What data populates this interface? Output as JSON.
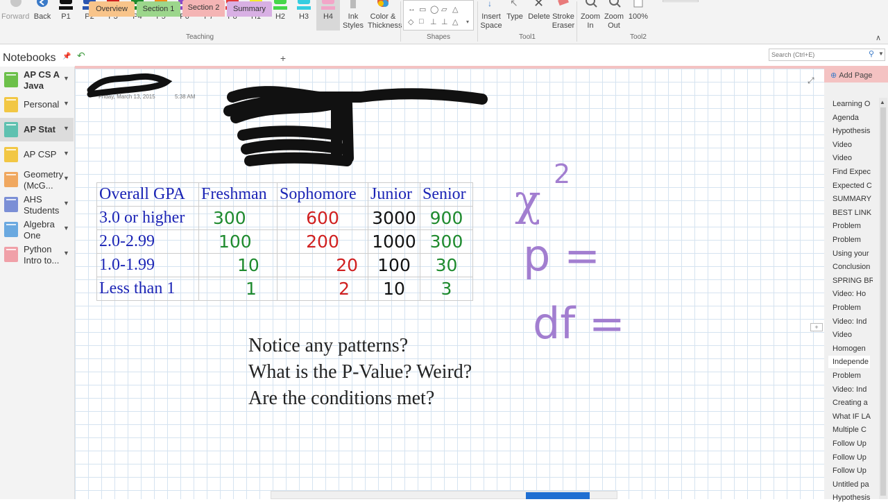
{
  "ribbon": {
    "history": [
      {
        "label": "Forward",
        "icon": "forward-arrow-icon"
      },
      {
        "label": "Back",
        "icon": "back-arrow-icon"
      }
    ],
    "pens": [
      {
        "label": "P1",
        "color": "#111111"
      },
      {
        "label": "P2",
        "color": "#2b55b0"
      },
      {
        "label": "P3",
        "color": "#d02020"
      },
      {
        "label": "P4",
        "color": "#1e8a2e"
      },
      {
        "label": "P5",
        "color": "#f08c1a"
      },
      {
        "label": "P6",
        "color": "#8a48c8"
      },
      {
        "label": "P7",
        "color": "#2eb34a"
      },
      {
        "label": "P8",
        "color": "#e23b3b"
      },
      {
        "label": "H1",
        "color": "#f5ee2a"
      },
      {
        "label": "H2",
        "color": "#46d64a"
      },
      {
        "label": "H3",
        "color": "#36cde0"
      },
      {
        "label": "H4",
        "color": "#f2a6c8"
      }
    ],
    "selected_pen": "H4",
    "ink_styles": "Ink\nStyles",
    "color_thickness": "Color &\nThickness",
    "groups": {
      "teaching": "Teaching",
      "shapes": "Shapes",
      "tool1": "Tool1",
      "tool2": "Tool2"
    },
    "tools": [
      {
        "label": "Insert\nSpace",
        "icon": "insert-space-icon"
      },
      {
        "label": "Type",
        "icon": "type-cursor-icon"
      },
      {
        "label": "Delete",
        "icon": "delete-x-icon"
      },
      {
        "label": "Stroke\nEraser",
        "icon": "eraser-icon"
      },
      {
        "label": "Zoom\nIn",
        "icon": "zoom-in-icon"
      },
      {
        "label": "Zoom\nOut",
        "icon": "zoom-out-icon"
      },
      {
        "label": "100%",
        "icon": "page-icon"
      }
    ]
  },
  "notebooks": {
    "title": "Notebooks",
    "items": [
      {
        "label": "AP CS A Java",
        "color": "#6cc04a"
      },
      {
        "label": "Personal",
        "color": "#f2c744"
      },
      {
        "label": "AP Stat",
        "color": "#5fc1b0"
      },
      {
        "label": "AP CSP",
        "color": "#f2c744"
      },
      {
        "label": "Geometry (McG...",
        "color": "#f0a860"
      },
      {
        "label": "AHS Students",
        "color": "#7b8fd6"
      },
      {
        "label": "Algebra One",
        "color": "#6aa9e0"
      },
      {
        "label": "Python Intro to...",
        "color": "#f0a0a8"
      }
    ],
    "active": "AP Stat"
  },
  "sections": {
    "tabs": [
      {
        "label": "Overview",
        "color": "#f8c48a"
      },
      {
        "label": "Section 1",
        "color": "#9cd68c"
      },
      {
        "label": "Section 2",
        "color": "#f4b4b4"
      },
      {
        "label": "Summary",
        "color": "#d8b0e4"
      }
    ],
    "active": "Section 2",
    "add_label": "+"
  },
  "search": {
    "placeholder": "Search (Ctrl+E)"
  },
  "page": {
    "date": "Friday, March 13, 2015",
    "time": "5:38 AM",
    "table": {
      "headers": [
        "Overall GPA",
        "Freshman",
        "Sophomore",
        "Junior",
        "Senior"
      ],
      "rows": [
        {
          "label": "3.0 or higher",
          "values": [
            "300",
            "600",
            "3000",
            "900"
          ]
        },
        {
          "label": "2.0-2.99",
          "values": [
            "100",
            "200",
            "1000",
            "300"
          ]
        },
        {
          "label": "1.0-1.99",
          "values": [
            "10",
            "20",
            "100",
            "30"
          ]
        },
        {
          "label": "Less than 1",
          "values": [
            "1",
            "2",
            "10",
            "3"
          ]
        }
      ],
      "ink_colors": [
        "#1e8a2e",
        "#d02020",
        "#111111",
        "#1e8a2e"
      ]
    },
    "questions": [
      "Notice any patterns?",
      "What is the P-Value? Weird?",
      "Are the conditions met?"
    ],
    "handwriting": {
      "chi": "χ",
      "squared": "2",
      "p": "p =",
      "df": "df ="
    }
  },
  "pages_panel": {
    "add_label": "Add Page",
    "items": [
      "Learning O",
      "Agenda",
      "Hypothesis",
      "Video",
      "Video",
      "Find Expec",
      "Expected C",
      "SUMMARY",
      "BEST LINK",
      "Problem",
      "Problem",
      "Using your",
      "Conclusion",
      "SPRING BR",
      "Video: Ho",
      "Problem",
      "Video: Ind",
      "Video",
      "Homogen",
      "Independe",
      "Problem",
      "Video: Ind",
      "Creating a",
      "What IF LA",
      "Multiple C",
      "Follow Up",
      "Follow Up",
      "Follow Up",
      "Untitled pa",
      "Hypothesis"
    ],
    "selected": "Independe"
  }
}
